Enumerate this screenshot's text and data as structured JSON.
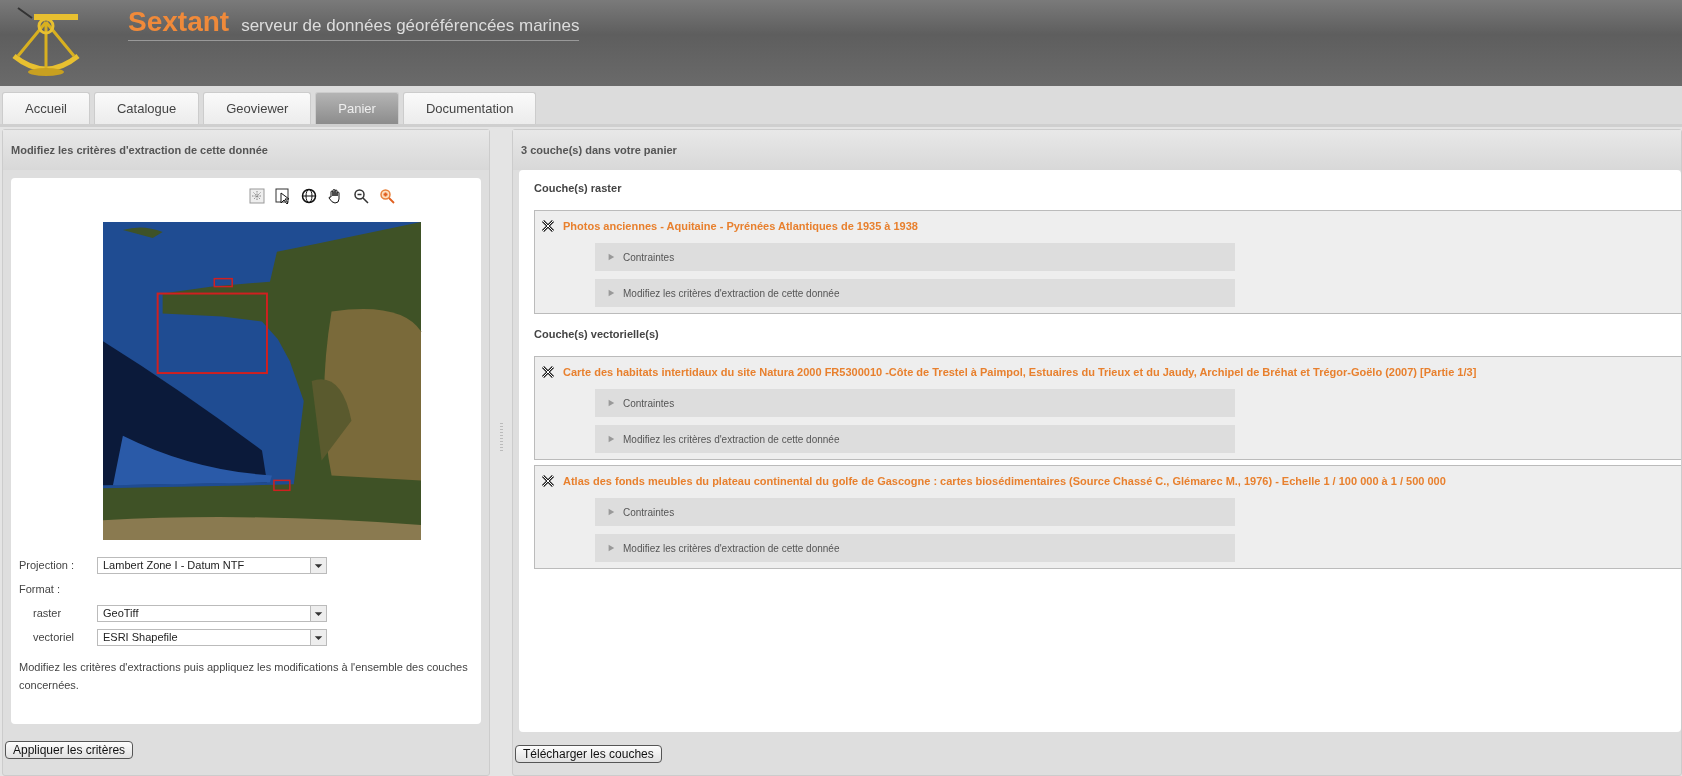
{
  "header": {
    "brand": "Sextant",
    "subtitle": "serveur de données géoréférencées marines"
  },
  "tabs": [
    {
      "label": "Accueil",
      "selected": false
    },
    {
      "label": "Catalogue",
      "selected": false
    },
    {
      "label": "Geoviewer",
      "selected": false
    },
    {
      "label": "Panier",
      "selected": true
    },
    {
      "label": "Documentation",
      "selected": false
    }
  ],
  "left_panel": {
    "title": "Modifiez les critères d'extraction de cette donnée",
    "projection": {
      "label": "Projection :",
      "value": "Lambert Zone I - Datum NTF"
    },
    "format_label": "Format :",
    "formats": [
      {
        "label": "raster",
        "value": "GeoTiff"
      },
      {
        "label": "vectoriel",
        "value": "ESRI Shapefile"
      }
    ],
    "note": "Modifiez les critères d'extractions puis appliquez les modifications à l'ensemble des couches concernées.",
    "button": "Appliquer les critères"
  },
  "right_panel": {
    "title": "3 couche(s) dans votre panier",
    "groups": [
      {
        "title": "Couche(s) raster",
        "layers": [
          {
            "title": "Photos anciennes - Aquitaine - Pyrénées Atlantiques de 1935 à 1938",
            "sections": [
              {
                "label": "Contraintes",
                "expanded": false
              },
              {
                "label": "Modifiez les critères d'extraction de cette donnée",
                "expanded": false
              }
            ]
          }
        ]
      },
      {
        "title": "Couche(s) vectorielle(s)",
        "layers": [
          {
            "title": "Carte des habitats intertidaux du site Natura 2000 FR5300010 -Côte de Trestel à Paimpol, Estuaires du Trieux et du Jaudy, Archipel de Bréhat et Trégor-Goëlo (2007) [Partie 1/3]",
            "sections": [
              {
                "label": "Contraintes",
                "expanded": false
              },
              {
                "label": "Modifiez les critères d'extraction de cette donnée",
                "expanded": false
              }
            ]
          },
          {
            "title": "Atlas des fonds meubles du plateau continental du golfe de Gascogne : cartes biosédimentaires (Source Chassé C., Glémarec M., 1976) - Echelle 1 / 100 000 à 1 / 500 000",
            "sections": [
              {
                "label": "Contraintes",
                "expanded": false
              },
              {
                "label": "Modifiez les critères d'extraction de cette donnée",
                "expanded": false
              }
            ]
          }
        ]
      }
    ],
    "button": "Télécharger les couches"
  }
}
